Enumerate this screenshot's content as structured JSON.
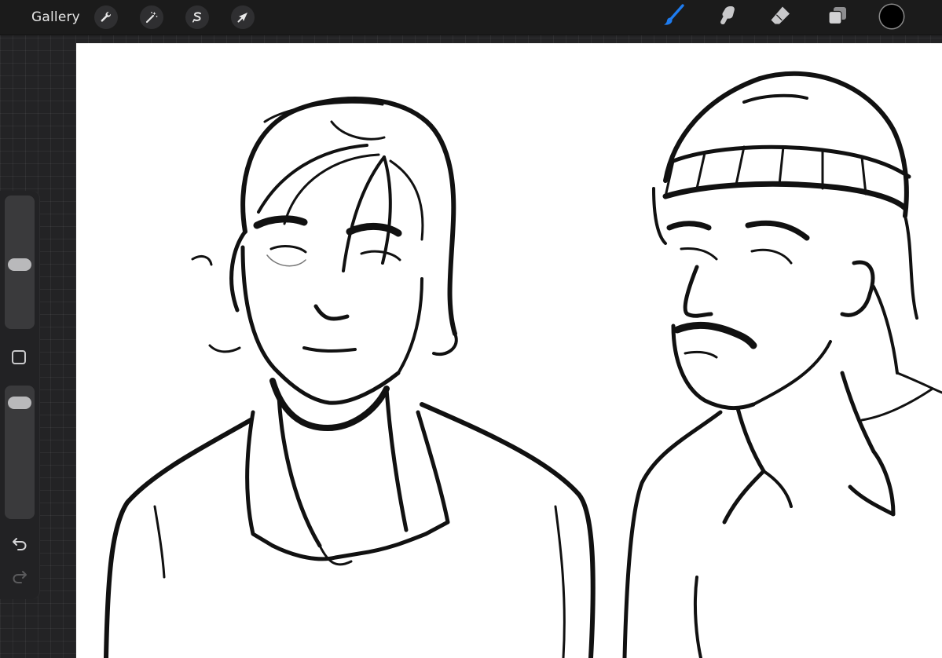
{
  "topbar": {
    "gallery_label": "Gallery",
    "left_tools": [
      {
        "name": "actions",
        "icon": "wrench-icon"
      },
      {
        "name": "adjustments",
        "icon": "magic-wand-icon"
      },
      {
        "name": "selection",
        "icon": "selection-s-icon"
      },
      {
        "name": "transform",
        "icon": "arrow-cursor-icon"
      }
    ],
    "right_tools": [
      {
        "name": "brush",
        "icon": "brush-icon",
        "active": true
      },
      {
        "name": "smudge",
        "icon": "smudge-finger-icon",
        "active": false
      },
      {
        "name": "eraser",
        "icon": "eraser-icon",
        "active": false
      },
      {
        "name": "layers",
        "icon": "layers-icon",
        "active": false
      }
    ],
    "current_color": "#000000",
    "active_tool_color": "#1e7cf0"
  },
  "sidebar": {
    "brush_size_level": 0.48,
    "brush_opacity_level": 0.93,
    "modifier_icon": "square-icon",
    "undo_icon": "undo-icon",
    "redo_icon": "redo-icon"
  },
  "canvas": {
    "background": "#ffffff",
    "content": "sketch-artwork"
  }
}
